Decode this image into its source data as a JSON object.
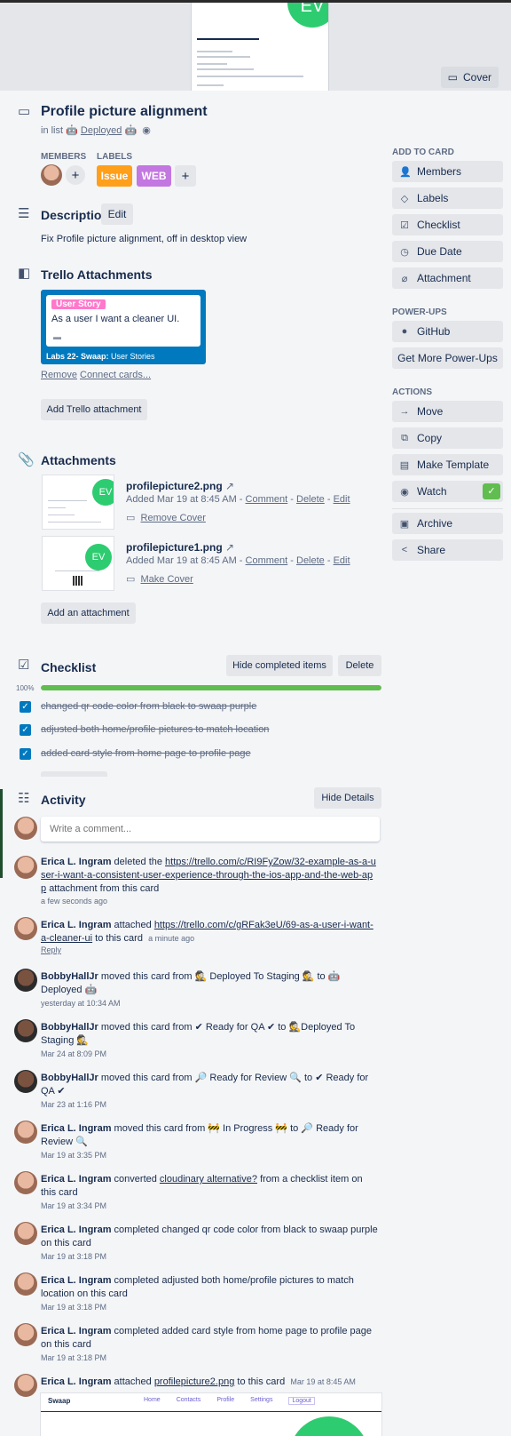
{
  "cover": {
    "thumb_avatar": "EV",
    "button_label": "Cover"
  },
  "card": {
    "title": "Profile picture alignment",
    "in_list_prefix": "in list",
    "list_name": "Deployed",
    "list_emoji": "🤖"
  },
  "members": {
    "heading": "MEMBERS"
  },
  "labels": {
    "heading": "LABELS",
    "items": [
      {
        "text": "Issue",
        "color": "#ff9f1a"
      },
      {
        "text": "WEB",
        "color": "#c377e0"
      }
    ]
  },
  "description": {
    "heading": "Description",
    "edit_label": "Edit",
    "text": "Fix Profile picture alignment, off in desktop view"
  },
  "trello_attachments": {
    "heading": "Trello Attachments",
    "card_label": "User Story",
    "card_title": "As a user I want a cleaner UI.",
    "board": "Labs 22- Swaap:",
    "list": "User Stories",
    "remove": "Remove",
    "connect": "Connect cards...",
    "add_button": "Add Trello attachment"
  },
  "attachments": {
    "heading": "Attachments",
    "items": [
      {
        "thumb_avatar": "EV",
        "name": "profilepicture2.png",
        "added": "Added Mar 19 at 8:45 AM -",
        "comment": "Comment",
        "delete": "Delete",
        "edit": "Edit",
        "cover_action": "Remove Cover"
      },
      {
        "thumb_avatar": "EV",
        "name": "profilepicture1.png",
        "added": "Added Mar 19 at 8:45 AM -",
        "comment": "Comment",
        "delete": "Delete",
        "edit": "Edit",
        "cover_action": "Make Cover"
      }
    ],
    "add_button": "Add an attachment"
  },
  "checklist": {
    "heading": "Checklist",
    "hide_button": "Hide completed items",
    "delete_button": "Delete",
    "progress_label": "100%",
    "progress_fraction": 1.0,
    "items": [
      "changed qr code color from black to swaap purple",
      "adjusted both home/profile pictures to match location",
      "added card style from home page to profile page"
    ]
  },
  "activity": {
    "heading": "Activity",
    "hide_details": "Hide Details",
    "comment_placeholder": "Write a comment...",
    "entries": [
      {
        "user": "Erica L. Ingram",
        "action": "deleted the",
        "link": "https://trello.com/c/RI9FyZow/32-example-as-a-user-i-want-a-consistent-user-experience-through-the-ios-app-and-the-web-app",
        "after": "attachment from this card",
        "time": "a few seconds ago"
      },
      {
        "user": "Erica L. Ingram",
        "action": "attached",
        "link": "https://trello.com/c/gRFak3eU/69-as-a-user-i-want-a-cleaner-ui",
        "after": "to this card",
        "inline_time": "a minute ago",
        "reply": "Reply"
      },
      {
        "user": "BobbyHallJr",
        "text": "moved this card from 🕵 Deployed To Staging 🕵 to 🤖 Deployed 🤖",
        "time": "yesterday at 10:34 AM"
      },
      {
        "user": "BobbyHallJr",
        "text": "moved this card from ✔ Ready for QA ✔ to 🕵Deployed To Staging 🕵",
        "time": "Mar 24 at 8:09 PM"
      },
      {
        "user": "BobbyHallJr",
        "text": "moved this card from 🔎 Ready for Review 🔍 to ✔ Ready for QA ✔",
        "time": "Mar 23 at 1:16 PM"
      },
      {
        "user": "Erica L. Ingram",
        "text": "moved this card from 🚧 In Progress 🚧 to 🔎 Ready for Review 🔍",
        "time": "Mar 19 at 3:35 PM"
      },
      {
        "user": "Erica L. Ingram",
        "action": "converted",
        "link": "cloudinary alternative?",
        "after": "from a checklist item on this card",
        "time": "Mar 19 at 3:34 PM"
      },
      {
        "user": "Erica L. Ingram",
        "text": "completed changed qr code color from black to swaap purple on this card",
        "time": "Mar 19 at 3:18 PM"
      },
      {
        "user": "Erica L. Ingram",
        "text": "completed adjusted both home/profile pictures to match location on this card",
        "time": "Mar 19 at 3:18 PM"
      },
      {
        "user": "Erica L. Ingram",
        "text": "completed added card style from home page to profile page on this card",
        "time": "Mar 19 at 3:18 PM"
      },
      {
        "user": "Erica L. Ingram",
        "action": "attached",
        "link": "profilepicture2.png",
        "after": "to this card",
        "inline_time": "Mar 19 at 8:45 AM"
      }
    ],
    "preview": {
      "logo": "Swaap",
      "nav": [
        "Home",
        "Contacts",
        "Profile",
        "Settings",
        "Logout"
      ]
    }
  },
  "sidebar": {
    "add_to_card": "ADD TO CARD",
    "add_items": [
      {
        "label": "Members",
        "icon": "person-icon"
      },
      {
        "label": "Labels",
        "icon": "tag-icon"
      },
      {
        "label": "Checklist",
        "icon": "checklist-icon"
      },
      {
        "label": "Due Date",
        "icon": "clock-icon"
      },
      {
        "label": "Attachment",
        "icon": "paperclip-icon"
      }
    ],
    "power_ups": "POWER-UPS",
    "github": "GitHub",
    "get_more": "Get More Power-Ups",
    "actions": "ACTIONS",
    "action_items": [
      {
        "label": "Move",
        "icon": "arrow-icon"
      },
      {
        "label": "Copy",
        "icon": "copy-icon"
      },
      {
        "label": "Make Template",
        "icon": "template-icon"
      },
      {
        "label": "Watch",
        "icon": "eye-icon"
      }
    ],
    "archive": "Archive",
    "share": "Share"
  },
  "colors": {
    "accent_blue": "#0079bf",
    "progress_green": "#61bd4f",
    "avatar_green": "#2ecc71"
  }
}
